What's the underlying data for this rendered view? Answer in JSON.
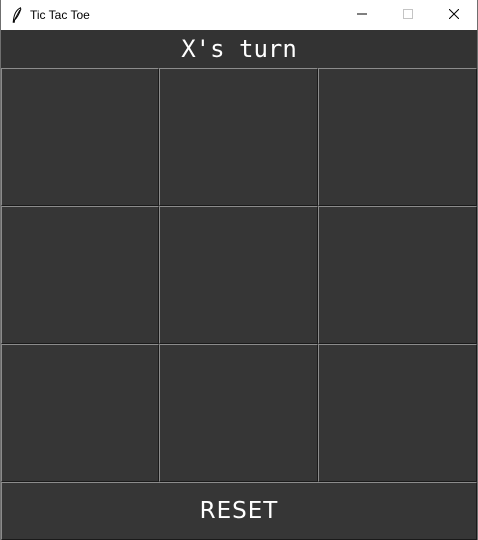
{
  "window": {
    "title": "Tic Tac Toe",
    "app_icon": "feather-icon",
    "controls": {
      "minimize_icon": "minimize-icon",
      "maximize_icon": "maximize-icon",
      "close_icon": "close-icon"
    }
  },
  "status": {
    "text": "X's turn"
  },
  "board": {
    "cells": [
      [
        "",
        "",
        ""
      ],
      [
        "",
        "",
        ""
      ],
      [
        "",
        "",
        ""
      ]
    ]
  },
  "reset": {
    "label": "RESET"
  },
  "colors": {
    "background": "#333333",
    "cell": "#363636",
    "text": "#ffffff"
  }
}
